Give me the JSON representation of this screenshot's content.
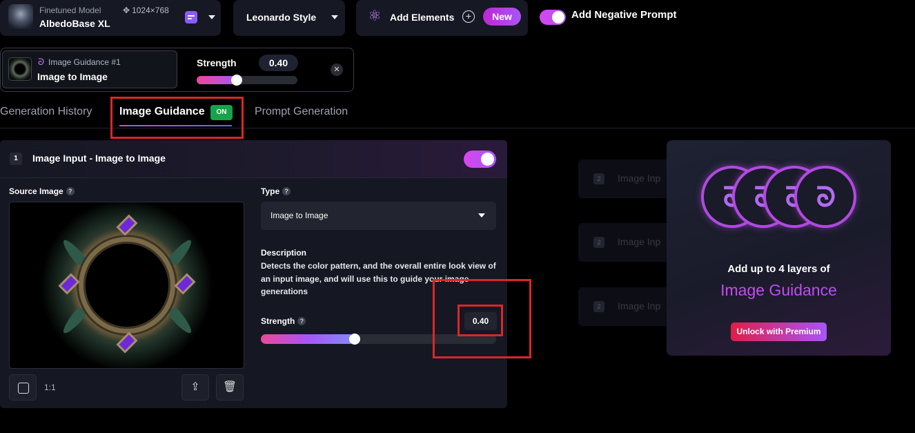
{
  "top_bar": {
    "model": {
      "label": "Finetuned Model",
      "name": "AlbedoBase XL",
      "dimensions": "1024×768"
    },
    "style": {
      "label": "Leonardo Style"
    },
    "elements": {
      "label": "Add Elements",
      "badge": "New"
    },
    "negative_prompt": {
      "label": "Add Negative Prompt",
      "enabled": true
    }
  },
  "guidance_chip": {
    "label": "Image Guidance #1",
    "title": "Image to Image",
    "strength_label": "Strength",
    "strength_value": "0.40",
    "strength": 0.4
  },
  "tabs": [
    {
      "label": "Generation History",
      "active": false
    },
    {
      "label": "Image Guidance",
      "active": true,
      "badge": "ON"
    },
    {
      "label": "Prompt Generation",
      "active": false
    }
  ],
  "card": {
    "step": "1",
    "title": "Image Input - Image to Image",
    "enabled": true,
    "source_label": "Source Image",
    "aspect_ratio": "1:1",
    "type_label": "Type",
    "type_value": "Image to Image",
    "description_label": "Description",
    "description_text": "Detects the color pattern, and the overall entire look view of an input image, and will use this to guide your image generations",
    "strength_label": "Strength",
    "strength_value": "0.40",
    "strength": 0.4
  },
  "ghost_layers": [
    {
      "num": "2",
      "label": "Image Inp"
    },
    {
      "num": "2",
      "label": "Image Inp"
    },
    {
      "num": "2",
      "label": "Image Inp"
    }
  ],
  "premium": {
    "title": "Add up to 4 layers of",
    "subtitle": "Image Guidance",
    "button": "Unlock with Premium"
  },
  "colors": {
    "accent_purple": "#a855f7",
    "accent_pink": "#ec4899",
    "on_green": "#16a34a",
    "highlight_red": "#dc2626"
  }
}
